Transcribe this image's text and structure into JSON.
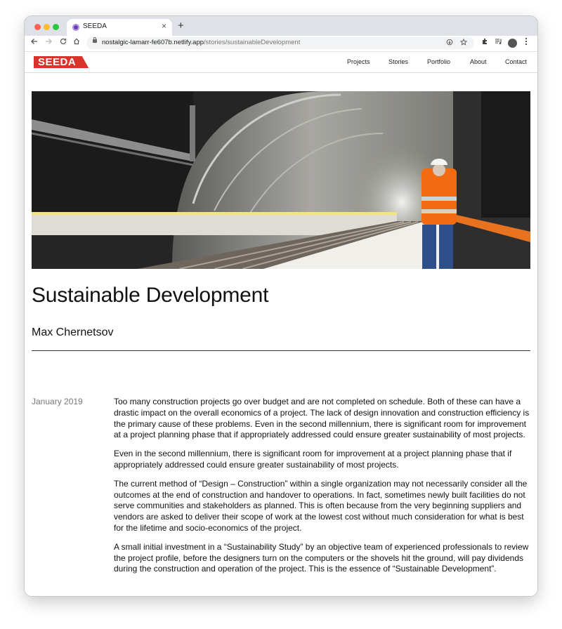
{
  "browser": {
    "tab_title": "SEEDA",
    "close_glyph": "×",
    "new_tab_glyph": "+",
    "url_host": "nostalgic-lamarr-fe607b.netlify.app",
    "url_path": "/stories/sustainableDevelopment",
    "icons": [
      "back-icon",
      "forward-icon",
      "reload-icon",
      "home-icon",
      "install-icon",
      "star-icon",
      "extensions-icon",
      "media-icon",
      "profile-icon",
      "more-icon"
    ]
  },
  "site": {
    "logo_text": "SEEDA",
    "brand_color": "#d9342b",
    "nav": [
      {
        "label": "Projects"
      },
      {
        "label": "Stories"
      },
      {
        "label": "Portfolio"
      },
      {
        "label": "About"
      },
      {
        "label": "Contact"
      }
    ]
  },
  "story": {
    "title": "Sustainable Development",
    "author": "Max Chernetsov",
    "date": "January 2019",
    "paragraphs": [
      "Too many construction projects go over budget and are not completed on schedule. Both of these can have a drastic impact on the overall economics of a project. The lack of design innovation and construction efficiency is the primary cause of these problems. Even in the second millennium, there is significant room for improvement at a project planning phase that if appropriately addressed could ensure greater sustainability of most projects.",
      "Even in the second millennium, there is significant room for improvement at a project planning phase that if appropriately addressed could ensure greater sustainability of most projects.",
      "The current method of “Design – Construction” within a single organization may not necessarily consider all the outcomes at the end of construction and handover to operations. In fact, sometimes newly built facilities do not serve communities and stakeholders as planned. This is often because from the very beginning suppliers and vendors are asked to deliver their scope of work at the lowest cost without much consideration for what is best for the lifetime and socio-economics of the project.",
      "A small initial investment in a “Sustainability Study” by an objective team of experienced professionals to review the project profile, before the designers turn on the computers or the shovels hit the ground, will pay dividends during the construction and operation of the project. This is the essence of “Sustainable Development”."
    ]
  }
}
